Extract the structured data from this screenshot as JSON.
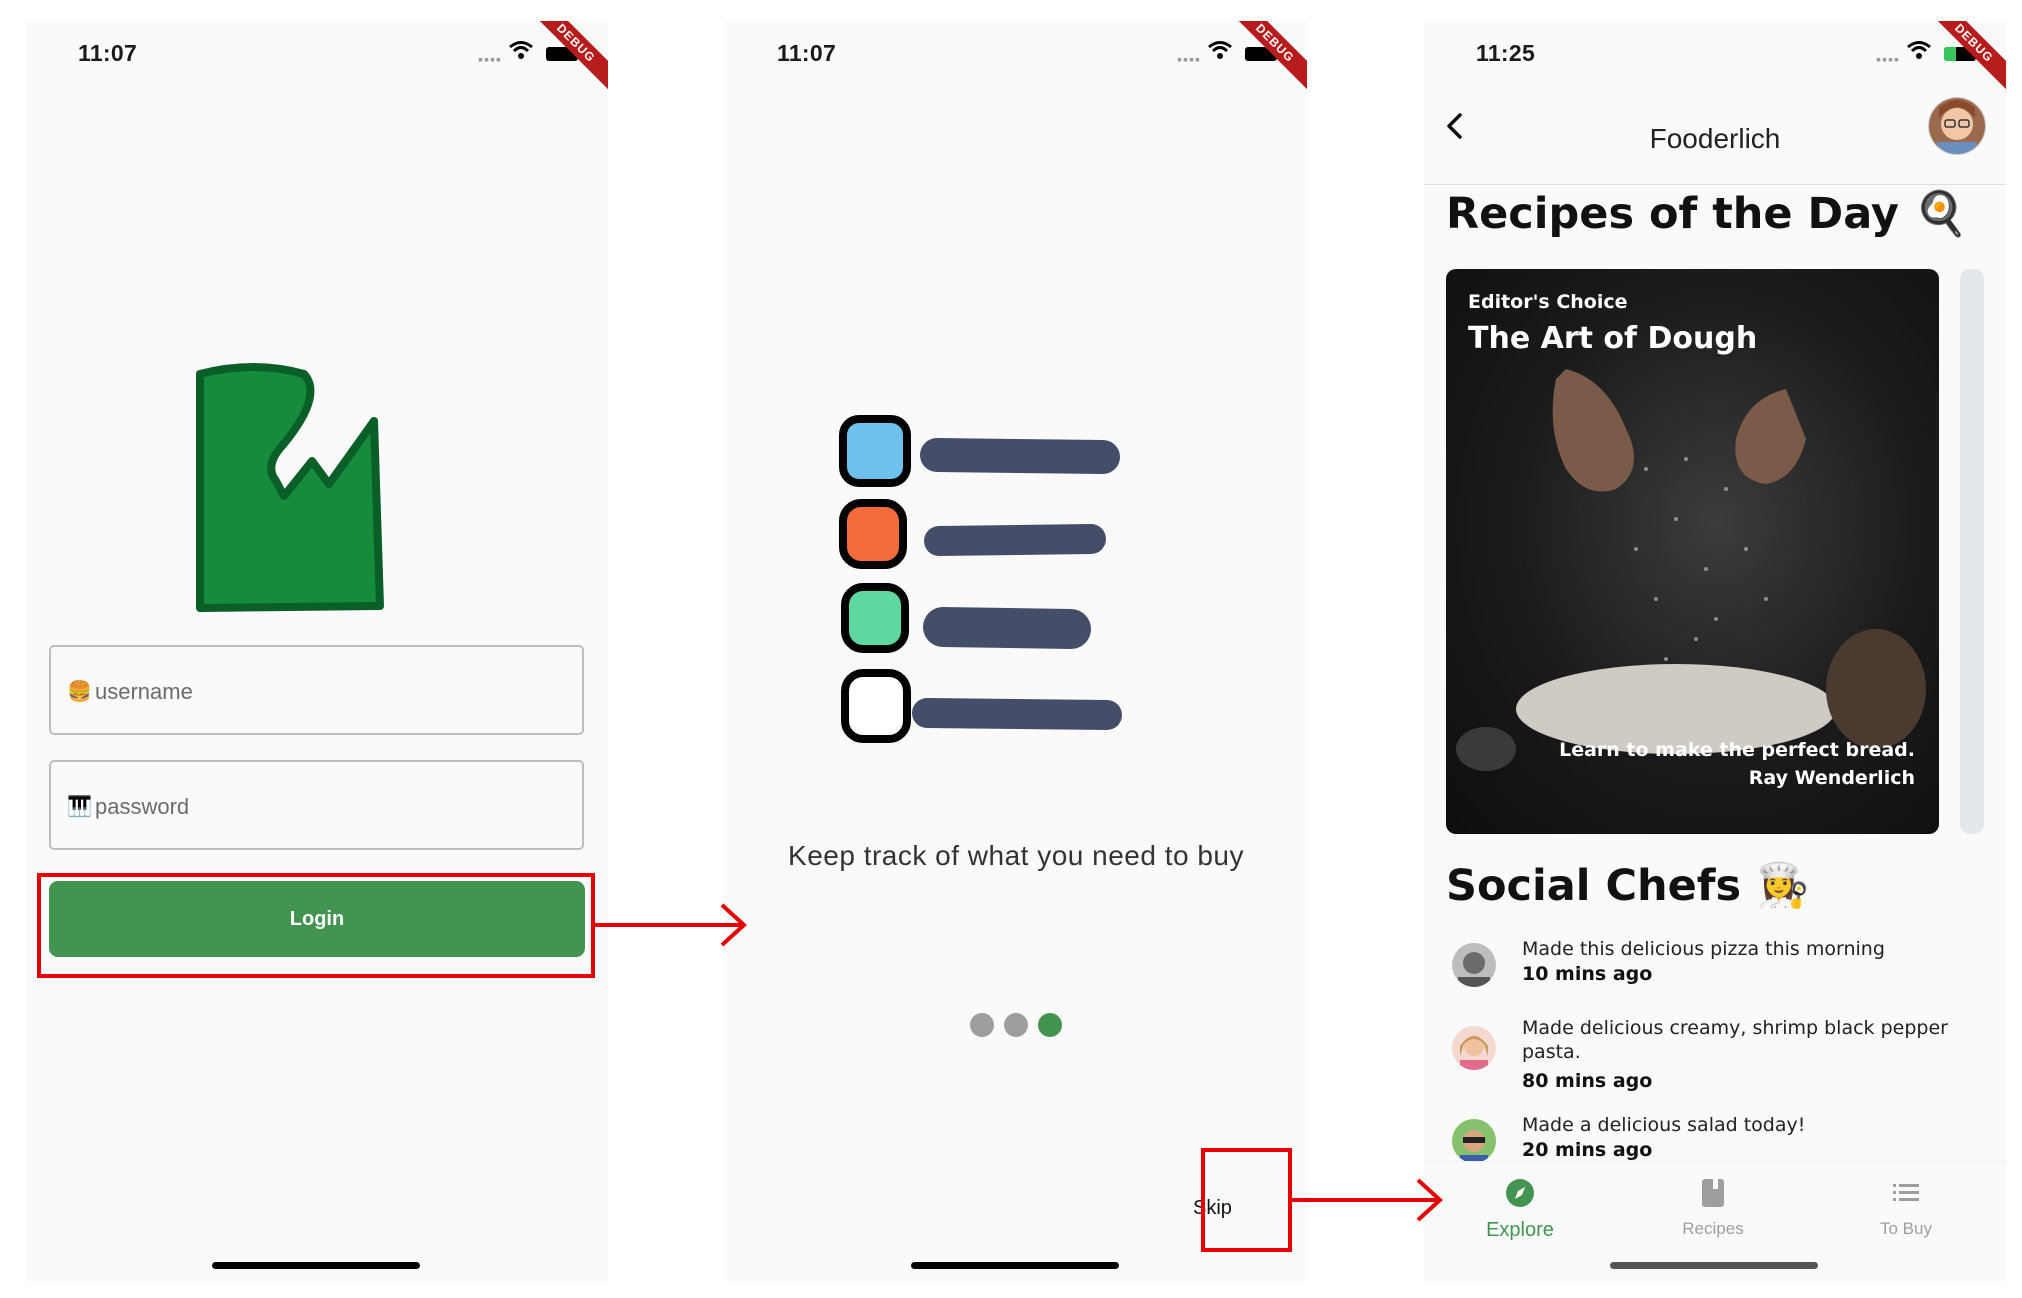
{
  "screen1": {
    "time": "11:07",
    "debug_banner": "DEBUG",
    "username_placeholder": "username",
    "password_placeholder": "password",
    "login_label": "Login"
  },
  "screen2": {
    "time": "11:07",
    "debug_banner": "DEBUG",
    "onboarding_text": "Keep track of what you need to buy",
    "page_count": 3,
    "active_page": 3,
    "skip_label": "Skip"
  },
  "screen3": {
    "time": "11:25",
    "debug_banner": "DEBUG",
    "app_title": "Fooderlich",
    "recipes_heading": "Recipes of the Day",
    "recipes_emoji": "🍳",
    "card": {
      "kicker": "Editor's Choice",
      "title": "The Art of Dough",
      "description": "Learn to make the perfect bread.",
      "author": "Ray Wenderlich"
    },
    "social_heading": "Social Chefs",
    "social_emoji": "👩‍🍳",
    "posts": [
      {
        "message": "Made this delicious pizza this morning",
        "ago": "10 mins ago"
      },
      {
        "message": "Made delicious creamy, shrimp black pepper pasta.",
        "ago": "80 mins ago"
      },
      {
        "message": "Made a delicious salad today!",
        "ago": "20 mins ago"
      }
    ],
    "tabs": [
      {
        "label": "Explore",
        "icon": "compass-icon",
        "active": true
      },
      {
        "label": "Recipes",
        "icon": "book-icon",
        "active": false
      },
      {
        "label": "To Buy",
        "icon": "list-icon",
        "active": false
      }
    ]
  },
  "colors": {
    "primary_green": "#439451",
    "highlight_red": "#e60000",
    "debug_red": "#b71c1c"
  }
}
